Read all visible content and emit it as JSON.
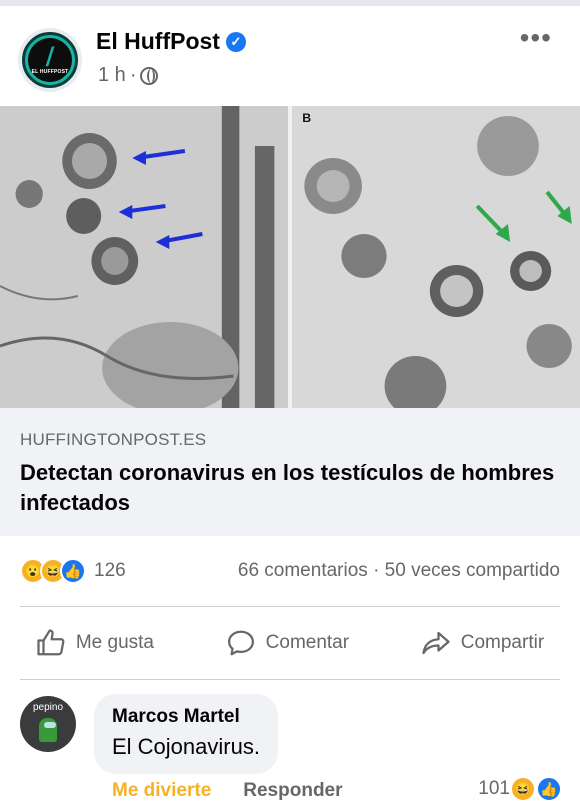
{
  "post": {
    "page_name": "El HuffPost",
    "time": "1 h",
    "separator": "·",
    "more_label": "•••",
    "avatar_text": "EL HUFFPOST"
  },
  "image": {
    "panel_b_label": "B"
  },
  "link_preview": {
    "domain": "HUFFINGTONPOST.ES",
    "headline": "Detectan coronavirus en los testículos de hombres infectados"
  },
  "stats": {
    "reaction_count": "126",
    "comments": "66 comentarios",
    "dot": "·",
    "shares": "50 veces compartido",
    "reactions": [
      "wow",
      "haha",
      "like"
    ]
  },
  "actions": {
    "like": "Me gusta",
    "comment": "Comentar",
    "share": "Compartir"
  },
  "comment": {
    "author": "Marcos Martel",
    "text": "El Cojonavirus.",
    "avatar_label": "pepino",
    "reaction_label": "Me divierte",
    "reply_label": "Responder",
    "reaction_count": "101"
  },
  "colors": {
    "brand": "#1877f2",
    "secondary_text": "#65676b",
    "haha": "#f7b125",
    "logo_accent": "#19b3a3"
  }
}
